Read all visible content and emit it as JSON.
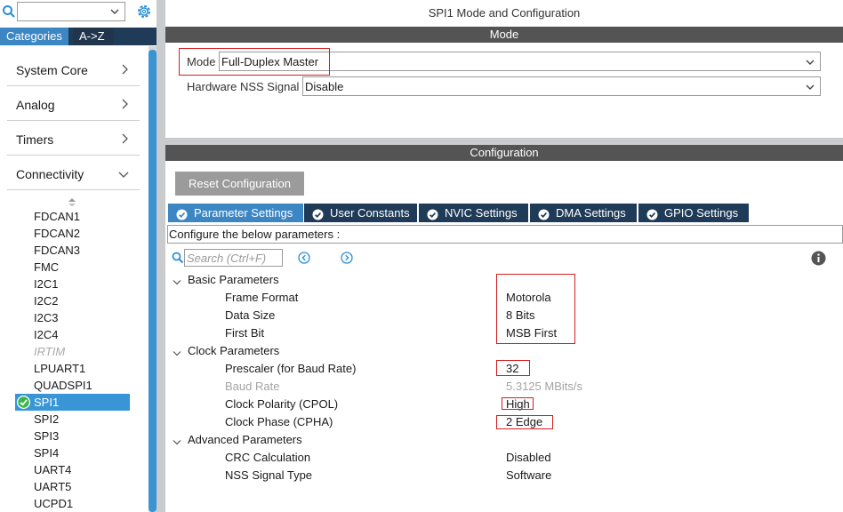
{
  "left_panel": {
    "category_select": {
      "value": ""
    },
    "tabs": {
      "categories": "Categories",
      "az": "A->Z"
    },
    "categories": [
      {
        "label": "System Core",
        "expanded": false
      },
      {
        "label": "Analog",
        "expanded": false
      },
      {
        "label": "Timers",
        "expanded": false
      },
      {
        "label": "Connectivity",
        "expanded": true
      }
    ],
    "peripherals": [
      {
        "label": "FDCAN1",
        "state": "normal"
      },
      {
        "label": "FDCAN2",
        "state": "normal"
      },
      {
        "label": "FDCAN3",
        "state": "normal"
      },
      {
        "label": "FMC",
        "state": "normal"
      },
      {
        "label": "I2C1",
        "state": "normal"
      },
      {
        "label": "I2C2",
        "state": "normal"
      },
      {
        "label": "I2C3",
        "state": "normal"
      },
      {
        "label": "I2C4",
        "state": "normal"
      },
      {
        "label": "IRTIM",
        "state": "disabled"
      },
      {
        "label": "LPUART1",
        "state": "normal"
      },
      {
        "label": "QUADSPI1",
        "state": "normal"
      },
      {
        "label": "SPI1",
        "state": "selected"
      },
      {
        "label": "SPI2",
        "state": "normal"
      },
      {
        "label": "SPI3",
        "state": "normal"
      },
      {
        "label": "SPI4",
        "state": "normal"
      },
      {
        "label": "UART4",
        "state": "normal"
      },
      {
        "label": "UART5",
        "state": "normal"
      },
      {
        "label": "UCPD1",
        "state": "normal"
      }
    ]
  },
  "main": {
    "title": "SPI1 Mode and Configuration",
    "mode_section": {
      "header": "Mode",
      "mode_label": "Mode",
      "mode_value": "Full-Duplex Master",
      "nss_label": "Hardware NSS Signal",
      "nss_value": "Disable"
    },
    "config_section": {
      "header": "Configuration",
      "reset_button": "Reset Configuration",
      "tabs": [
        {
          "label": "Parameter Settings",
          "active": true
        },
        {
          "label": "User Constants",
          "active": false
        },
        {
          "label": "NVIC Settings",
          "active": false
        },
        {
          "label": "DMA Settings",
          "active": false
        },
        {
          "label": "GPIO Settings",
          "active": false
        }
      ],
      "configure_text": "Configure the below parameters :",
      "search_placeholder": "Search (Ctrl+F)",
      "groups": [
        {
          "name": "Basic Parameters",
          "params": [
            {
              "name": "Frame Format",
              "value": "Motorola"
            },
            {
              "name": "Data Size",
              "value": "8 Bits"
            },
            {
              "name": "First Bit",
              "value": "MSB First"
            }
          ]
        },
        {
          "name": "Clock Parameters",
          "params": [
            {
              "name": "Prescaler (for Baud Rate)",
              "value": "32"
            },
            {
              "name": "Baud Rate",
              "value": "5.3125 MBits/s",
              "readonly": true
            },
            {
              "name": "Clock Polarity (CPOL)",
              "value": "High"
            },
            {
              "name": "Clock Phase (CPHA)",
              "value": "2 Edge"
            }
          ]
        },
        {
          "name": "Advanced Parameters",
          "params": [
            {
              "name": "CRC Calculation",
              "value": "Disabled"
            },
            {
              "name": "NSS Signal Type",
              "value": "Software"
            }
          ]
        }
      ]
    }
  },
  "colors": {
    "accent_blue": "#3c86c4",
    "selected_blue": "#3996d6",
    "dark_tab": "#1f3b57",
    "band_gray": "#545454",
    "highlight_red": "#d21f1f"
  }
}
